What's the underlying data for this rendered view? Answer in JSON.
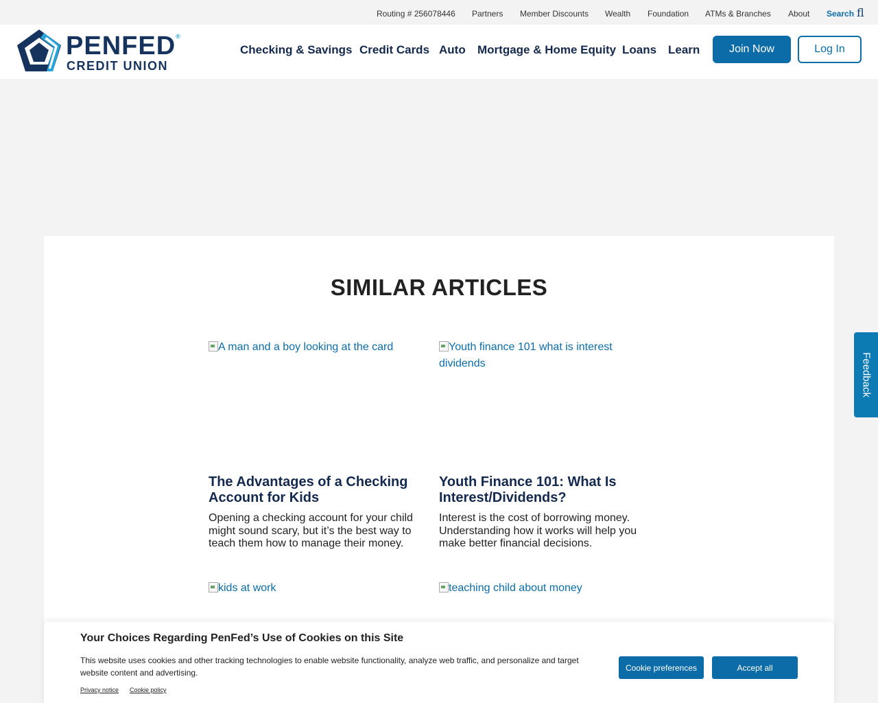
{
  "utility_bar": {
    "routing": "Routing # 256078446",
    "partners": "Partners",
    "member_discounts": "Member Discounts",
    "wealth": "Wealth",
    "foundation": "Foundation",
    "atms": "ATMs & Branches",
    "about": "About",
    "search": "Search",
    "search_glyph": "fl"
  },
  "logo": {
    "name": "PENFED",
    "registered": "®",
    "subtitle": "CREDIT UNION"
  },
  "nav": {
    "checking": "Checking & Savings",
    "credit_cards": "Credit Cards",
    "auto": "Auto",
    "mortgage": "Mortgage & Home Equity",
    "loans": "Loans",
    "learn": "Learn",
    "join": "Join Now",
    "login": "Log In"
  },
  "colors": {
    "brand_blue": "#0c6ca8",
    "navy": "#14294d",
    "feedback": "#0c7bb3"
  },
  "section_title": "SIMILAR ARTICLES",
  "articles": [
    {
      "image_alt": "A man and a boy looking at the card",
      "title": "The Advantages of a Checking Account for Kids",
      "description": "Opening a checking account for your child might sound scary, but it’s the best way to teach them how to manage their money."
    },
    {
      "image_alt": "Youth finance 101 what is interest dividends",
      "title": "Youth Finance 101: What Is Interest/Dividends?",
      "description": "Interest is the cost of borrowing money. Understanding how it works will help you make better financial decisions."
    },
    {
      "image_alt": "kids at work"
    },
    {
      "image_alt": "teaching child about money"
    }
  ],
  "feedback": "Feedback",
  "cookie_banner": {
    "title": "Your Choices Regarding PenFed’s Use of Cookies on this Site",
    "text": "This website uses cookies and other tracking technologies to enable website functionality, analyze web traffic, and personalize and target website content and advertising.",
    "privacy_notice": "Privacy notice",
    "cookie_policy": "Cookie policy",
    "preferences_button": "Cookie preferences",
    "accept_button": "Accept all"
  }
}
